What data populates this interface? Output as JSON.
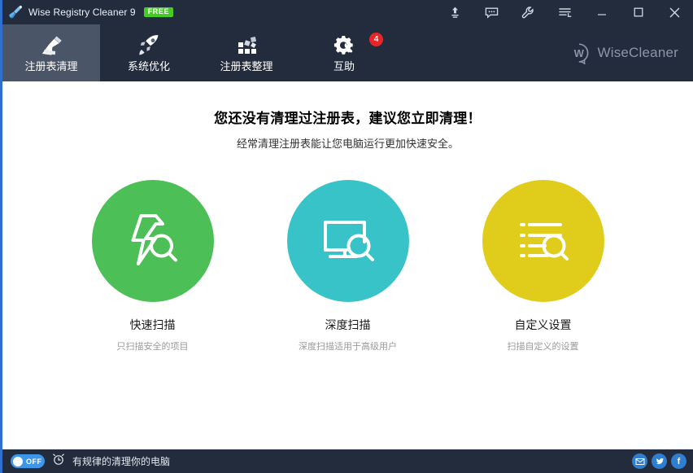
{
  "window": {
    "title": "Wise Registry Cleaner 9",
    "badge": "FREE",
    "app_icon": "broom-icon",
    "controls": [
      {
        "name": "upgrade-icon",
        "label": "Upgrade"
      },
      {
        "name": "feedback-icon",
        "label": "Feedback"
      },
      {
        "name": "wrench-icon",
        "label": "Tools"
      },
      {
        "name": "menu-icon",
        "label": "Menu"
      },
      {
        "name": "minimize-icon",
        "label": "Minimize"
      },
      {
        "name": "maximize-icon",
        "label": "Maximize"
      },
      {
        "name": "close-icon",
        "label": "Close"
      }
    ]
  },
  "tabs": [
    {
      "label": "注册表清理",
      "icon": "broom-icon",
      "active": true,
      "badge": ""
    },
    {
      "label": "系统优化",
      "icon": "rocket-icon",
      "active": false,
      "badge": ""
    },
    {
      "label": "注册表整理",
      "icon": "blocks-icon",
      "active": false,
      "badge": ""
    },
    {
      "label": "互助",
      "icon": "gear-wrench-icon",
      "active": false,
      "badge": "4"
    }
  ],
  "brand": {
    "name": "WiseCleaner",
    "mark": "W"
  },
  "main": {
    "headline": "您还没有清理过注册表，建议您立即清理！",
    "subhead": "经常清理注册表能让您电脑运行更加快速安全。",
    "actions": [
      {
        "title": "快速扫描",
        "desc": "只扫描安全的项目",
        "color": "#4CBF57",
        "icon": "lightning-search-icon"
      },
      {
        "title": "深度扫描",
        "desc": "深度扫描适用于高级用户",
        "color": "#38C3C8",
        "icon": "monitor-search-icon"
      },
      {
        "title": "自定义设置",
        "desc": "扫描自定义的设置",
        "color": "#DFCC1B",
        "icon": "list-search-icon"
      }
    ]
  },
  "statusbar": {
    "toggle_state": "OFF",
    "clock_icon": "alarm-clock-icon",
    "text": "有规律的清理你的电脑",
    "socials": [
      {
        "name": "email-icon",
        "glyph": "✉",
        "color": "#2f7fd0"
      },
      {
        "name": "twitter-icon",
        "glyph": "🐦",
        "color": "#2f7fd0"
      },
      {
        "name": "facebook-icon",
        "glyph": "f",
        "color": "#2f7fd0"
      }
    ]
  },
  "colors": {
    "chrome": "#232c3d",
    "tab_active": "#4a5568",
    "accent_border": "#2f6fd0",
    "badge_free": "#44cc22",
    "badge_alert": "#e8262a"
  }
}
